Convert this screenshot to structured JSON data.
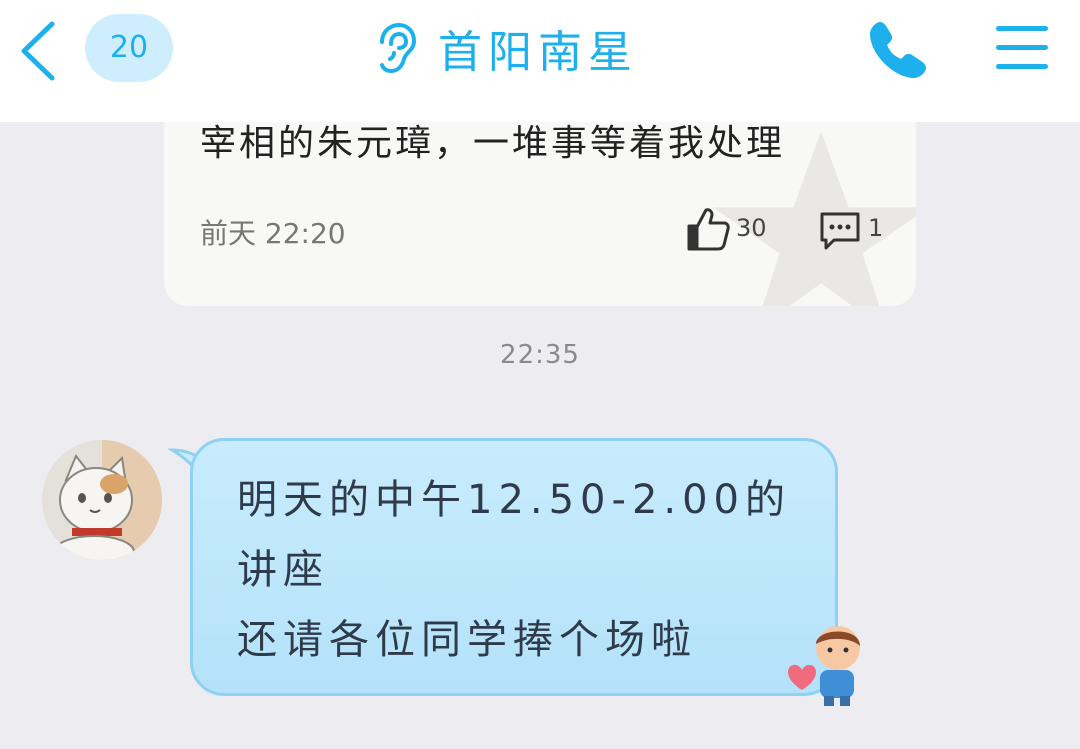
{
  "header": {
    "unread_count": "20",
    "title": "首阳南星",
    "back_icon": "chevron-left-icon",
    "ear_icon": "ear-icon",
    "phone_icon": "phone-icon",
    "menu_icon": "hamburger-menu-icon"
  },
  "prev_card": {
    "text": "宰相的朱元璋，一堆事等着我处理",
    "time": "前天 22:20",
    "like_count": "30",
    "comment_count": "1"
  },
  "message_time": "22:35",
  "message": {
    "lines": [
      "明天的中午12.50-2.00的",
      "讲座",
      "还请各位同学捧个场啦"
    ]
  },
  "colors": {
    "accent": "#1db0ec",
    "bubble": "#c8ecfc",
    "bubble_border": "#8fd1f3",
    "background": "#ededf1"
  }
}
